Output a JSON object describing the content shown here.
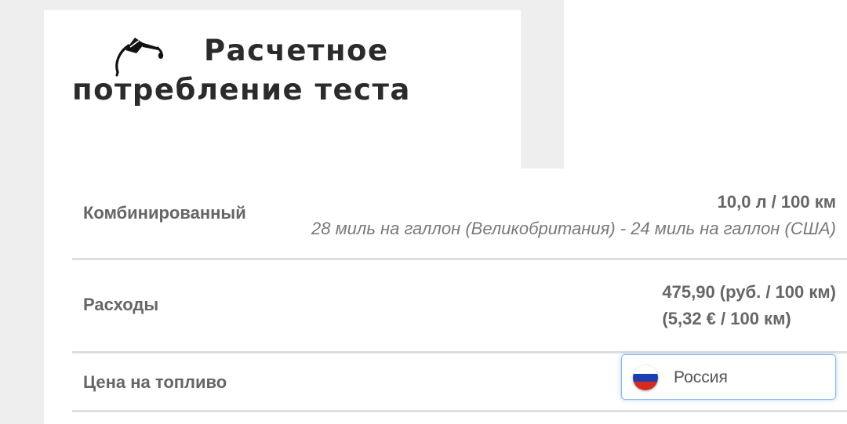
{
  "header": {
    "title": "Расчетное потребление теста",
    "icon": "fuel-nozzle-icon"
  },
  "rows": [
    {
      "label": "Комбинированный",
      "value_main": "10,0 л / 100 км",
      "value_sub": "28 миль на галлон (Великобритания) - 24 миль на галлон (США)"
    },
    {
      "label": "Расходы",
      "value_main": "475,90 (руб. / 100 км)",
      "value_sub": "(5,32 € / 100 км)"
    },
    {
      "label": "Цена на топливо",
      "select_value": "Россия",
      "flag_colors": [
        "#ffffff",
        "#1c3fb0",
        "#d52b1e"
      ]
    }
  ],
  "colors": {
    "label": "#666666",
    "title": "#2b2b2b",
    "divider": "#dedede",
    "select_border": "#82b7e8"
  }
}
